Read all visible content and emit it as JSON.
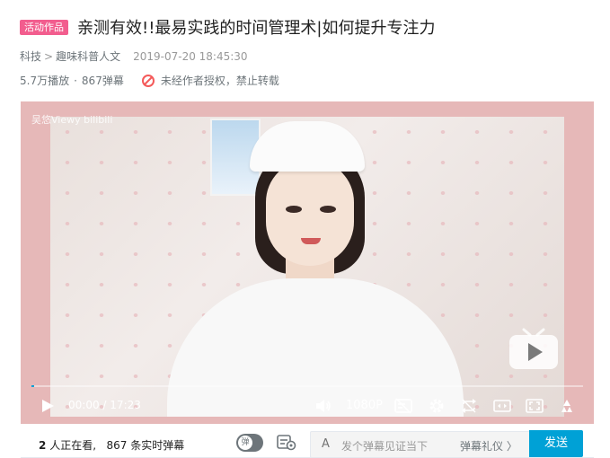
{
  "header": {
    "tag": "活动作品",
    "title": "亲测有效!!最易实践的时间管理术|如何提升专注力"
  },
  "meta": {
    "category": "科技",
    "subcategory": "趣味科普人文",
    "separator": ">",
    "date": "2019-07-20 18:45:30"
  },
  "stats": {
    "views": "5.7万播放",
    "dot": "·",
    "danmaku_count": "867弹幕",
    "copyright": "未经作者授权，禁止转载"
  },
  "player": {
    "watermark": "吴悠Viewy  bilibili",
    "current_time": "00:00",
    "time_sep": "/",
    "duration": "17:23",
    "quality": "1080P",
    "progress": 0.0
  },
  "bottom": {
    "watching_count": "2",
    "watching_text": "人正在看,",
    "live_danmaku_count": "867",
    "live_danmaku_text": "条实时弹幕",
    "toggle_label": "弹",
    "input_icon": "A",
    "input_placeholder": "发个弹幕见证当下",
    "etiquette": "弹幕礼仪 〉",
    "send": "发送"
  },
  "colors": {
    "accent": "#00a1d6",
    "tag": "#f25d8e",
    "player_bg": "#e6b8b8"
  }
}
